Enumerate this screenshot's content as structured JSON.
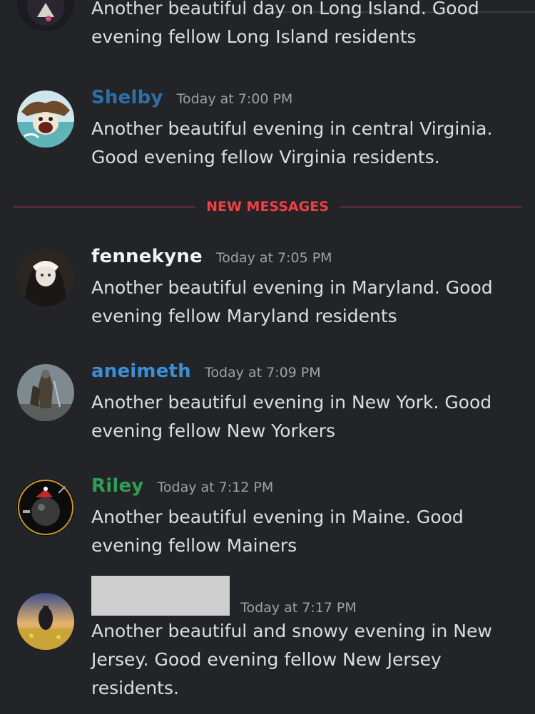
{
  "messages": [
    {
      "username": "",
      "timestamp": "",
      "text": "Another beautiful day on Long Island. Good evening fellow Long Island residents",
      "username_color": "#ffffff"
    },
    {
      "username": "Shelby",
      "timestamp": "Today at 7:00 PM",
      "text": "Another beautiful evening in central Virginia. Good evening fellow Virginia residents.",
      "username_color": "#2f6fa8"
    },
    {
      "username": "fennekyne",
      "timestamp": "Today at 7:05 PM",
      "text": "Another beautiful evening in Maryland. Good evening fellow Maryland residents",
      "username_color": "#f2f3f5"
    },
    {
      "username": "aneimeth",
      "timestamp": "Today at 7:09 PM",
      "text": "Another beautiful evening in New York. Good evening fellow New Yorkers",
      "username_color": "#3b8fd6"
    },
    {
      "username": "Riley",
      "timestamp": "Today at 7:12 PM",
      "text": "Another beautiful evening in Maine. Good evening fellow Mainers",
      "username_color": "#2e9e57"
    },
    {
      "username": "",
      "timestamp": "Today at 7:17 PM",
      "text": "Another beautiful and snowy evening in New Jersey. Good evening fellow New Jersey residents.",
      "username_color": "#cfcfcf"
    }
  ],
  "new_messages_divider": "NEW MESSAGES",
  "colors": {
    "background": "#232428",
    "text": "#dbdee1",
    "timestamp": "#9ea1a8",
    "new_messages_red": "#f23f42"
  }
}
